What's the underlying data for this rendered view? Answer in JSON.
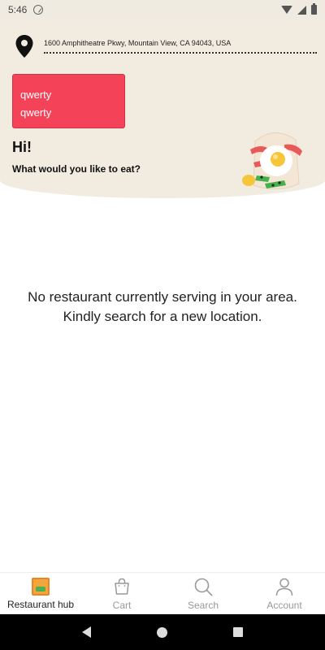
{
  "status_bar": {
    "time": "5:46"
  },
  "header": {
    "address": "1600 Amphitheatre Pkwy, Mountain View, CA 94043, USA",
    "promo": {
      "line1": "qwerty",
      "line2": "qwerty",
      "color": "#f44358"
    },
    "greeting": "Hi!",
    "subgreeting": "What would you like to eat?"
  },
  "main": {
    "empty_line1": "No restaurant currently serving in your area.",
    "empty_line2": "Kindly search for a new location."
  },
  "bottom_nav": {
    "items": [
      {
        "label": "Restaurant hub",
        "icon": "restaurant-hub-icon",
        "active": true
      },
      {
        "label": "Cart",
        "icon": "cart-icon",
        "active": false
      },
      {
        "label": "Search",
        "icon": "search-icon",
        "active": false
      },
      {
        "label": "Account",
        "icon": "account-icon",
        "active": false
      }
    ]
  },
  "colors": {
    "header_bg": "#f2ece0",
    "accent": "#f44358"
  }
}
